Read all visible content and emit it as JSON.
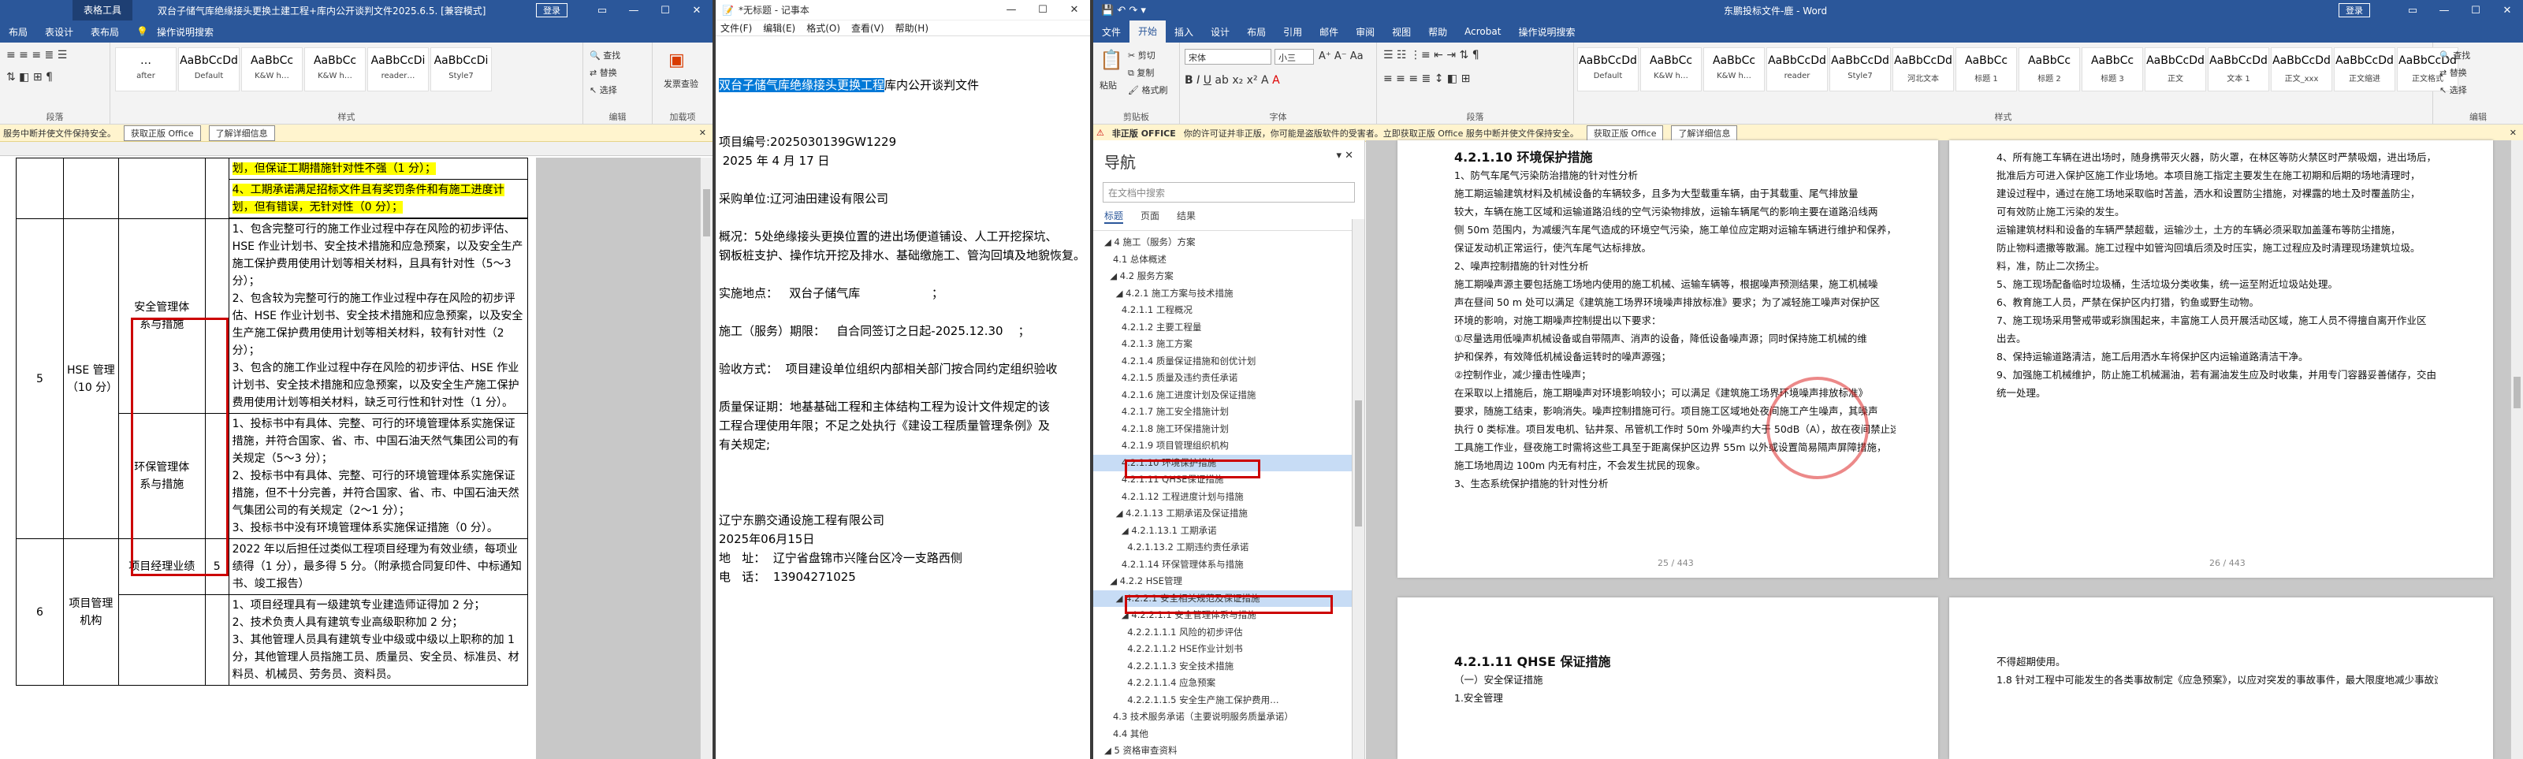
{
  "excel": {
    "tool_tab": "表格工具",
    "title": "双台子储气库绝缘接头更换土建工程+库内公开谈判文件2025.6.5. [兼容模式] - Word",
    "login": "登录",
    "tabs": [
      "布局",
      "表设计",
      "表布局",
      "操作说明搜索"
    ],
    "styles": [
      {
        "preview": "…",
        "name": "after"
      },
      {
        "preview": "AaBbCcDd",
        "name": "Default"
      },
      {
        "preview": "AaBbCc",
        "name": "K&W h…"
      },
      {
        "preview": "AaBbCc",
        "name": "K&W h…"
      },
      {
        "preview": "AaBbCcDi",
        "name": "reader…"
      },
      {
        "preview": "AaBbCcDi",
        "name": "Style7"
      }
    ],
    "ribbon": {
      "find": "查找",
      "replace": "替换",
      "select": "选择",
      "addon": "加载项",
      "addon_label": "发票查验",
      "grp_para": "段落",
      "grp_styles": "样式",
      "grp_edit": "编辑",
      "grp_addons": "加载项"
    },
    "msgbar": {
      "text": "服务中断并使文件保持安全。",
      "btn1": "获取正版 Office",
      "btn2": "了解详细信息"
    },
    "table": {
      "r_hl1": "划，但保证工期措施针对性不强（1 分）；",
      "r_hl2": "4、工期承诺满足招标文件且有奖罚条件和有施工进度计划，但有错误，无针对性（0 分）；",
      "r_safe": "1、包含完整可行的施工作业过程中存在风险的初步评估、HSE 作业计划书、安全技术措施和应急预案，以及安全生产施工保护费用使用计划等相关材料，且具有针对性（5～3 分）；",
      "r_safe2": "2、包含较为完整可行的施工作业过程中存在风险的初步评估、HSE 作业计划书、安全技术措施和应急预案，以及安全生产施工保护费用使用计划等相关材料，较有针对性（2 分）；",
      "r_safe3": "3、包含的施工作业过程中存在风险的初步评估、HSE 作业计划书、安全技术措施和应急预案，以及安全生产施工保护费用使用计划等相关材料，缺乏可行性和针对性（1 分）。",
      "cat_safe": "安全管理体系与措施",
      "cat_env": "环保管理体系与措施",
      "hse": "HSE 管理（10 分）",
      "idx5": "5",
      "r_env1": "1、投标书中有具体、完整、可行的环境管理体系实施保证措施，并符合国家、省、市、中国石油天然气集团公司的有关规定（5～3 分）；",
      "r_env2": "2、投标书中有具体、完整、可行的环境管理体系实施保证措施，但不十分完善，并符合国家、省、市、中国石油天然气集团公司的有关规定（2～1 分）；",
      "r_env3": "3、投标书中没有环境管理体系实施保证措施（0 分）。",
      "pm": "项目经理业绩",
      "pm_score": "5",
      "pm_text": "2022 年以后担任过类似工程项目经理为有效业绩，每项业绩得（1 分），最多得 5 分。（附承揽合同复印件、中标通知书、竣工报告）",
      "idx6": "6",
      "org": "项目管理机构",
      "org1": "1、项目经理具有一级建筑专业建造师证得加 2 分；",
      "org2": "2、技术负责人具有建筑专业高级职称加 2 分；",
      "org3": "3、其他管理人员具有建筑专业中级或中级以上职称的加 1 分，其他管理人员指施工员、质量员、安全员、标准员、材料员、机械员、劳务员、资料员。"
    }
  },
  "notepad": {
    "title": "*无标题 - 记事本",
    "menu": [
      "文件(F)",
      "编辑(E)",
      "格式(O)",
      "查看(V)",
      "帮助(H)"
    ],
    "sel": "双台子储气库绝缘接头更换工程",
    "line1_rest": "库内公开谈判文件",
    "lines": [
      "项目编号:2025030139GW1229",
      " 2025 年 4 月 17 日",
      "",
      "采购单位:辽河油田建设有限公司",
      "",
      "概况：5处绝缘接头更换位置的进出场便道铺设、人工开挖探坑、",
      "钢板桩支护、操作坑开挖及排水、基础缴施工、管沟回填及地貌恢复。",
      "",
      "实施地点：   双台子储气库                   ；",
      "",
      "施工（服务）期限：   自合同签订之日起-2025.12.30    ；",
      "",
      "验收方式：  项目建设单位组织内部相关部门按合同约定组织验收",
      "",
      "质量保证期：地基基础工程和主体结构工程为设计文件规定的该",
      "工程合理使用年限；不足之处执行《建设工程质量管理条例》及",
      "有关规定;",
      "",
      "",
      "",
      "辽宁东鹏交通设施工程有限公司",
      "2025年06月15日",
      "地   址：  辽宁省盘锦市兴隆台区冷一支路西侧",
      "电   话：  13904271025"
    ],
    "ctl": [
      "—",
      "☐",
      "✕"
    ]
  },
  "word": {
    "title": "东鹏投标文件-鹿 - Word",
    "login": "登录",
    "tabs": [
      "文件",
      "开始",
      "插入",
      "设计",
      "布局",
      "引用",
      "邮件",
      "审阅",
      "视图",
      "帮助",
      "Acrobat",
      "操作说明搜索"
    ],
    "font": "宋体",
    "size": "小三",
    "clipboard": {
      "cut": "剪切",
      "copy": "复制",
      "painter": "格式刷",
      "paste": "粘贴",
      "label": "剪贴板"
    },
    "font_label": "字体",
    "para_label": "段落",
    "styles_label": "样式",
    "edit_label": "编辑",
    "addon_label": "加载项",
    "styles": [
      {
        "preview": "AaBbCcDd",
        "name": "Default"
      },
      {
        "preview": "AaBbCc",
        "name": "K&W h…"
      },
      {
        "preview": "AaBbCc",
        "name": "K&W h…"
      },
      {
        "preview": "AaBbCcDd",
        "name": "reader"
      },
      {
        "preview": "AaBbCcDd",
        "name": "Style7"
      },
      {
        "preview": "AaBbCcDd",
        "name": "河北文本"
      },
      {
        "preview": "AaBbCc",
        "name": "标题 1"
      },
      {
        "preview": "AaBbCc",
        "name": "标题 2"
      },
      {
        "preview": "AaBbCc",
        "name": "标题 3"
      },
      {
        "preview": "AaBbCcDd",
        "name": "正文"
      },
      {
        "preview": "AaBbCcDd",
        "name": "文本 1"
      },
      {
        "preview": "AaBbCcDd",
        "name": "正文_xxx"
      },
      {
        "preview": "AaBbCcDd",
        "name": "正文缩进"
      },
      {
        "preview": "AaBbCcDd",
        "name": "正文格式"
      }
    ],
    "msgbar": {
      "label": "非正版 OFFICE",
      "text": "你的许可证并非正版，你可能是盗版软件的受害者。立即获取正版 Office 服务中断并使文件保持安全。",
      "btn1": "获取正版 Office",
      "btn2": "了解详细信息"
    },
    "nav": {
      "title": "导航",
      "search": "在文档中搜索",
      "tabs": [
        "标题",
        "页面",
        "结果"
      ],
      "items": [
        "◢ 4 施工（服务）方案",
        "   4.1 总体概述",
        "  ◢ 4.2 服务方案",
        "    ◢ 4.2.1 施工方案与技术措施",
        "      4.2.1.1 工程概况",
        "      4.2.1.2 主要工程量",
        "      4.2.1.3 施工方案",
        "      4.2.1.4 质量保证措施和创优计划",
        "      4.2.1.5 质量及违约责任承诺",
        "      4.2.1.6 施工进度计划及保证措施",
        "      4.2.1.7 施工安全措施计划",
        "      4.2.1.8 施工环保措施计划",
        "      4.2.1.9 项目管理组织机构",
        "      4.2.1.10 环境保护措施",
        "      4.2.1.11 QHSE保证措施",
        "      4.2.1.12 工程进度计划与措施",
        "    ◢ 4.2.1.13 工期承诺及保证措施",
        "      ◢ 4.2.1.13.1 工期承诺",
        "        4.2.1.13.2 工期违约责任承诺",
        "      4.2.1.14 环保管理体系与措施",
        "  ◢ 4.2.2 HSE管理",
        "    ◢ 4.2.2.1 安全相关规范及保证措施",
        "      ◢ 4.2.2.1.1 安全管理体系与措施",
        "        4.2.2.1.1.1 风险的初步评估",
        "        4.2.2.1.1.2 HSE作业计划书",
        "        4.2.2.1.1.3 安全技术措施",
        "        4.2.2.1.1.4 应急预案",
        "        4.2.2.1.1.5 安全生产施工保护费用…",
        "   4.3 技术服务承诺（主要说明服务质量承诺）",
        "   4.4 其他",
        "◢ 5 资格审查资料"
      ]
    },
    "page1": {
      "heading": "4.2.1.10 环境保护措施",
      "lines": [
        "1、防气车尾气污染防治措施的针对性分析",
        "施工期运输建筑材料及机械设备的车辆较多，且多为大型载重车辆，由于其载重、尾气排放量",
        "较大，车辆在施工区域和运输道路沿线的空气污染物排放，运输车辆尾气的影响主要在道路沿线两",
        "侧 50m 范围内，为减缓汽车尾气造成的环境空气污染，施工单位应定期对运输车辆进行维护和保养，",
        "保证发动机正常运行，使汽车尾气达标排放。",
        "2、噪声控制措施的针对性分析",
        "施工期噪声源主要包括施工场地内使用的施工机械、运输车辆等，根据噪声预测结果，施工机械噪",
        "声在昼间 50 m 处可以满足《建筑施工场界环境噪声排放标准》要求；为了减轻施工噪声对保护区",
        "环境的影响，对施工期噪声控制提出以下要求：",
        "①尽量选用低噪声机械设备或自带隔声、消声的设备，降低设备噪声源；同时保持施工机械的维",
        "护和保养，有效降低机械设备运转时的噪声源强；",
        "②控制作业，减少撞击性噪声；",
        "在采取以上措施后，施工期噪声对环境影响较小；可以满足《建筑施工场界环境噪声排放标准》",
        "要求，随施工结束，影响消失。噪声控制措施可行。项目施工区域地处夜间施工产生噪声，其噪声",
        "执行 0 类标准。项目发电机、钻井泵、吊管机工作时 50m 外噪声约大于 50dB（A），故在夜间禁止这些",
        "工具施工作业，昼夜施工时需将这些工具至于距离保护区边界 55m 以外或设置简易隔声屏障措施，",
        "施工场地周边 100m 内无有村庄，不会发生扰民的现象。",
        "3、生态系统保护措施的针对性分析"
      ],
      "pagenum": "25 / 443"
    },
    "page2": {
      "lines": [
        "4、所有施工车辆在进出场时，随身携带灭火器，防火罩，在林区等防火禁区时严禁吸烟，进出场后，",
        "批准后方可进入保护区施工作业场地。本项目施工指定主要发生在施工初期和后期的场地清理时，",
        "建设过程中，通过在施工场地采取临时苫盖，洒水和设置防尘措施，对裸露的地土及时覆盖防尘，",
        "可有效防止施工污染的发生。",
        "运输建筑材料和设备的车辆严禁超载，运输沙土，土方的车辆必须采取加盖蓬布等防尘措施，",
        "防止物料遗撒等散漏。施工过程中如管沟回填后须及时压实，施工过程应及时清理现场建筑垃圾。",
        "料，准，防止二次扬尘。",
        "5、施工现场配备临时垃圾桶，生活垃圾分类收集，统一运至附近垃圾站处理。",
        "6、教育施工人员，严禁在保护区内打猎，钓鱼或野生动物。",
        "7、施工现场采用警戒带或彩旗围起来，丰富施工人员开展活动区域，施工人员不得擅自离开作业区",
        "出去。",
        "8、保持运输道路清洁，施工后用洒水车将保护区内运输道路清洁干净。",
        "9、加强施工机械维护，防止施工机械漏油，若有漏油发生应及时收集，并用专门容器妥善储存，交由",
        "统一处理。"
      ],
      "pagenum": "26 / 443"
    },
    "page3": {
      "heading": "4.2.1.11 QHSE 保证措施",
      "lines": [
        "（一）安全保证措施",
        "1.安全管理"
      ]
    },
    "page4": {
      "lines": [
        "不得超期使用。",
        "1.8 针对工程中可能发生的各类事故制定《应急预案》，以应对突发的事故事件，最大限度地减少事故造成的损失。"
      ]
    }
  }
}
